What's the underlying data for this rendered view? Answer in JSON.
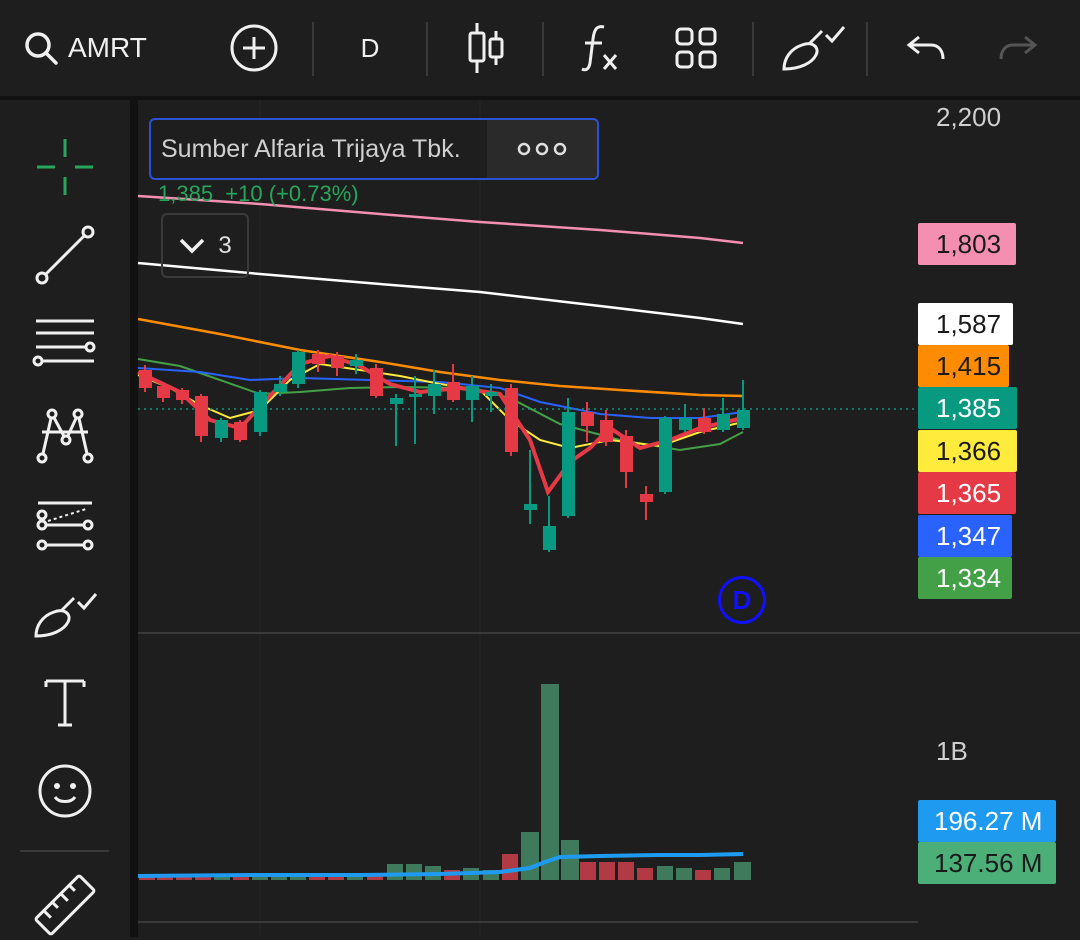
{
  "toolbar": {
    "symbol": "AMRT",
    "interval": "D",
    "icons": [
      "search-icon",
      "add-icon",
      "candles-icon",
      "indicators-icon",
      "layout-grid-icon",
      "brush-icon",
      "undo-icon",
      "redo-icon"
    ]
  },
  "legend": {
    "name": "Sumber Alfaria Trijaya Tbk.",
    "change_text": "1,385  +10 (+0.73%)",
    "collapsed_count": "3"
  },
  "left_tools": [
    "crosshair-icon",
    "trendline-icon",
    "fib-icon",
    "pattern-icon",
    "projection-icon",
    "brush-icon",
    "text-icon",
    "emoji-icon",
    "ruler-icon"
  ],
  "price_axis": {
    "top_label": "2,200",
    "tags": [
      {
        "value": "1,803",
        "bg": "#f48fb1",
        "fg": "#1a1a1a"
      },
      {
        "value": "1,587",
        "bg": "#ffffff",
        "fg": "#1a1a1a"
      },
      {
        "value": "1,415",
        "bg": "#ff8c00",
        "fg": "#1a1a1a"
      },
      {
        "value": "1,385",
        "bg": "#089981",
        "fg": "#ffffff"
      },
      {
        "value": "1,366",
        "bg": "#ffeb3b",
        "fg": "#1a1a1a"
      },
      {
        "value": "1,365",
        "bg": "#e53945",
        "fg": "#ffffff"
      },
      {
        "value": "1,347",
        "bg": "#2962ff",
        "fg": "#ffffff"
      },
      {
        "value": "1,334",
        "bg": "#43a047",
        "fg": "#ffffff"
      }
    ]
  },
  "volume_axis": {
    "label_1b": "1B",
    "tags": [
      {
        "value": "196.27 M",
        "bg": "#1e9bf0",
        "fg": "#ffffff"
      },
      {
        "value": "137.56 M",
        "bg": "#4caf78",
        "fg": "#1a1a1a"
      }
    ]
  },
  "dividend_badge": "D",
  "colors": {
    "up": "#089981",
    "down": "#e53945",
    "background": "#1e1e1e"
  }
}
